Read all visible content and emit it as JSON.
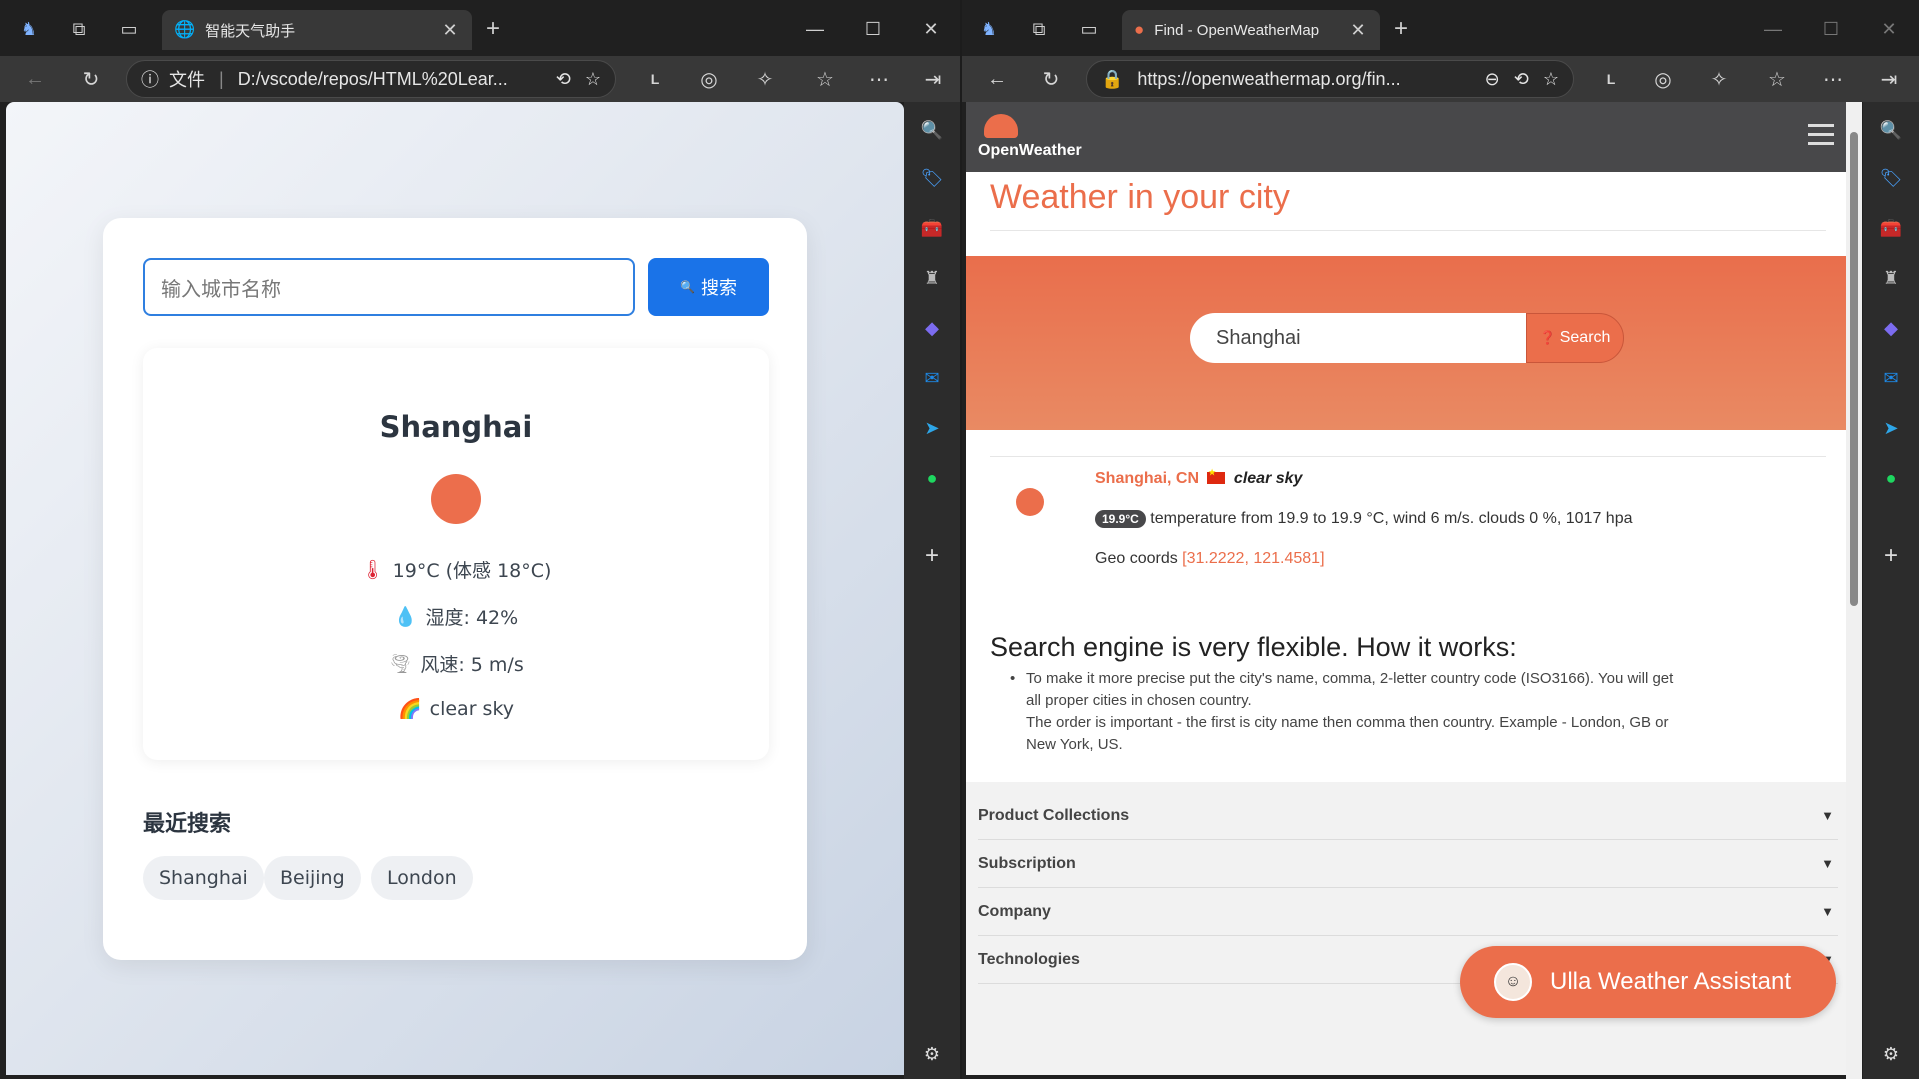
{
  "left_browser": {
    "tab_title": "智能天气助手",
    "address_label": "文件",
    "address_url": "D:/vscode/repos/HTML%20Lear..."
  },
  "right_browser": {
    "tab_title": "Find - OpenWeatherMap",
    "address_url": "https://openweathermap.org/fin..."
  },
  "weather_app": {
    "search_placeholder": "输入城市名称",
    "search_button": "搜索",
    "city": "Shanghai",
    "temperature": "19°C (体感 18°C)",
    "humidity": "湿度: 42%",
    "wind": "风速: 5 m/s",
    "description": "clear sky",
    "recent_title": "最近搜索",
    "recent": [
      "Shanghai",
      "Beijing",
      "London"
    ],
    "icons": {
      "temp": "thermometer-icon",
      "humidity": "droplet-icon",
      "wind": "tornado-icon",
      "desc": "rainbow-icon",
      "search": "magnifier-icon"
    },
    "colors": {
      "accent": "#1a73e8",
      "sun": "#ec6e4c"
    }
  },
  "openweather": {
    "logo": "OpenWeather",
    "page_title": "Weather in your city",
    "search_value": "Shanghai",
    "search_button": "Search",
    "result_city": "Shanghai, CN",
    "result_sky": "clear sky",
    "temp_badge": "19.9°C",
    "details": "temperature from 19.9 to 19.9 °C, wind 6 m/s. clouds 0 %, 1017 hpa",
    "geo_label": "Geo coords",
    "geo_value": "[31.2222, 121.4581]",
    "how_title": "Search engine is very flexible. How it works:",
    "how_p1": "To make it more precise put the city's name, comma, 2-letter country code (ISO3166). You will get all proper cities in chosen country.",
    "how_p2": "The order is important - the first is city name then comma then country. Example - London, GB or New York, US.",
    "footer_items": [
      "Product Collections",
      "Subscription",
      "Company",
      "Technologies"
    ],
    "assistant": "Ulla Weather Assistant",
    "colors": {
      "brand": "#eb6e4b",
      "header": "#48484a"
    }
  }
}
